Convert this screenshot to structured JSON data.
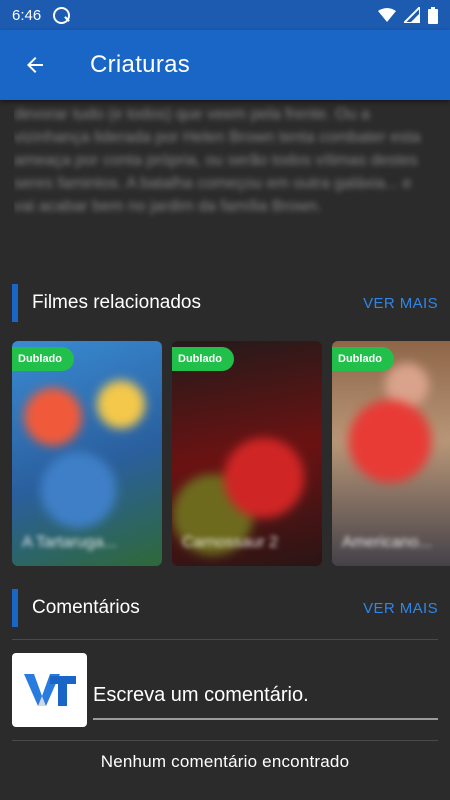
{
  "status_bar": {
    "time": "6:46",
    "icons": [
      "app-notification-icon",
      "wifi-icon",
      "signal-icon",
      "battery-icon"
    ]
  },
  "app_bar": {
    "title": "Criaturas",
    "back_icon": "arrow-left-icon"
  },
  "synopsis": {
    "text": "devorar tudo (e todos) que veem pela frente. Ou a vizinhança liderada por Helen Brown tenta combater esta ameaça por conta própria, ou serão todos vítimas destes seres famintos. A batalha começou em outra galáxia... e vai acabar bem no jardim da família Brown."
  },
  "related": {
    "title": "Filmes relacionados",
    "more_label": "VER MAIS",
    "movies": [
      {
        "badge": "Dublado",
        "title": "A Tartaruga..."
      },
      {
        "badge": "Dublado",
        "title": "Carnossaur 2"
      },
      {
        "badge": "Dublado",
        "title": "Americano..."
      }
    ]
  },
  "comments": {
    "title": "Comentários",
    "more_label": "VER MAIS",
    "placeholder": "Escreva um comentário.",
    "empty_text": "Nenhum comentário encontrado",
    "avatar_icon": "vt-logo-icon"
  },
  "colors": {
    "app_bar": "#1a66c7",
    "status_bar": "#1c5bb0",
    "accent_link": "#2f86e8",
    "badge": "#21c04a",
    "background": "#2b2b2b"
  }
}
